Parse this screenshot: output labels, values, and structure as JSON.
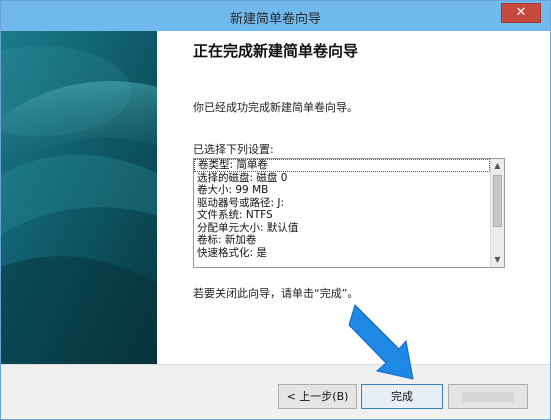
{
  "window": {
    "title": "新建简单卷向导",
    "close_glyph": "✕"
  },
  "content": {
    "heading": "正在完成新建简单卷向导",
    "intro": "你已经成功完成新建简单卷向导。",
    "list_caption": "已选择下列设置:",
    "settings": [
      "卷类型: 简单卷",
      "选择的磁盘: 磁盘 0",
      "卷大小: 99 MB",
      "驱动器号或路径: J:",
      "文件系统: NTFS",
      "分配单元大小: 默认值",
      "卷标: 新加卷",
      "快速格式化: 是"
    ],
    "selected_index": 0,
    "close_hint": "若要关闭此向导，请单击“完成”。"
  },
  "buttons": {
    "back": "< 上一步(B)",
    "finish": "完成"
  },
  "icons": {
    "scroll_up": "up-arrow-icon",
    "scroll_down": "down-arrow-icon",
    "annotation_arrow": "pointer-arrow-icon"
  },
  "colors": {
    "titlebar": "#70b9ec",
    "banner": "#0d4f5e",
    "close_button": "#c74a3f",
    "annotation_arrow": "#1e88e5"
  }
}
